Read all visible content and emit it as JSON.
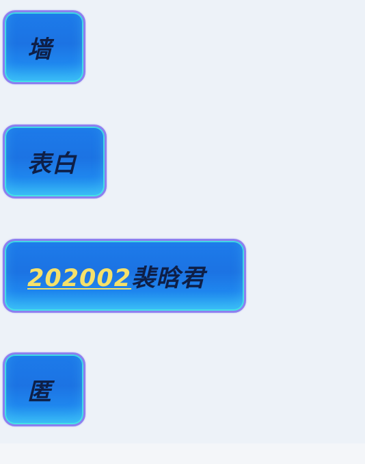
{
  "tags": [
    {
      "text": "墙"
    },
    {
      "text": "表白"
    },
    {
      "number": "202002",
      "text": "裴晗君"
    },
    {
      "text": "匿"
    }
  ],
  "colors": {
    "page_background": "#edf2f8",
    "tag_fill": "#1c73e3",
    "tag_border": "#8c7ff0",
    "tag_glow": "#48e8e2",
    "tag_text": "#0e1f47",
    "highlight_number": "#f5e16a"
  }
}
